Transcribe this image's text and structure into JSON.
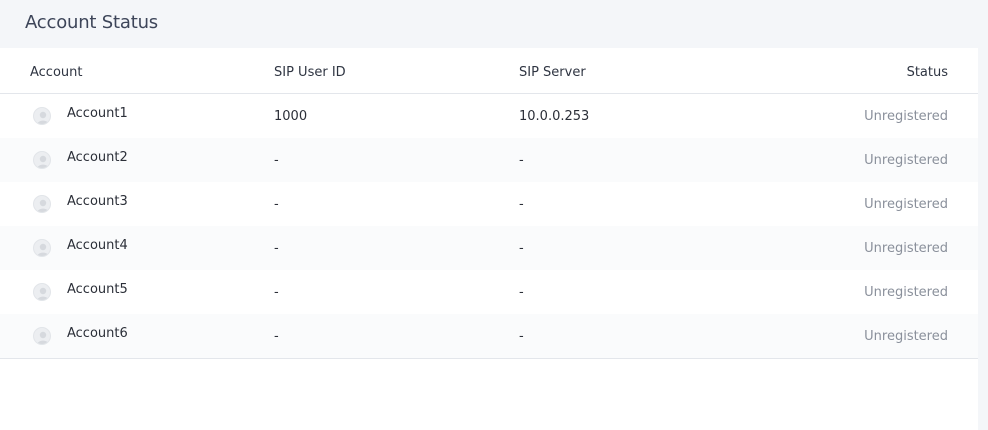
{
  "panel": {
    "title": "Account Status"
  },
  "table": {
    "columns": {
      "account": "Account",
      "user_id": "SIP User ID",
      "server": "SIP Server",
      "status": "Status"
    },
    "rows": [
      {
        "account": "Account1",
        "user_id": "1000",
        "server": "10.0.0.253",
        "status": "Unregistered"
      },
      {
        "account": "Account2",
        "user_id": "-",
        "server": "-",
        "status": "Unregistered"
      },
      {
        "account": "Account3",
        "user_id": "-",
        "server": "-",
        "status": "Unregistered"
      },
      {
        "account": "Account4",
        "user_id": "-",
        "server": "-",
        "status": "Unregistered"
      },
      {
        "account": "Account5",
        "user_id": "-",
        "server": "-",
        "status": "Unregistered"
      },
      {
        "account": "Account6",
        "user_id": "-",
        "server": "-",
        "status": "Unregistered"
      }
    ]
  },
  "icons": {
    "avatar": "user-avatar-icon"
  },
  "colors": {
    "background": "#f4f6f9",
    "status_text": "#8a909b",
    "alt_row": "#fafbfc"
  }
}
